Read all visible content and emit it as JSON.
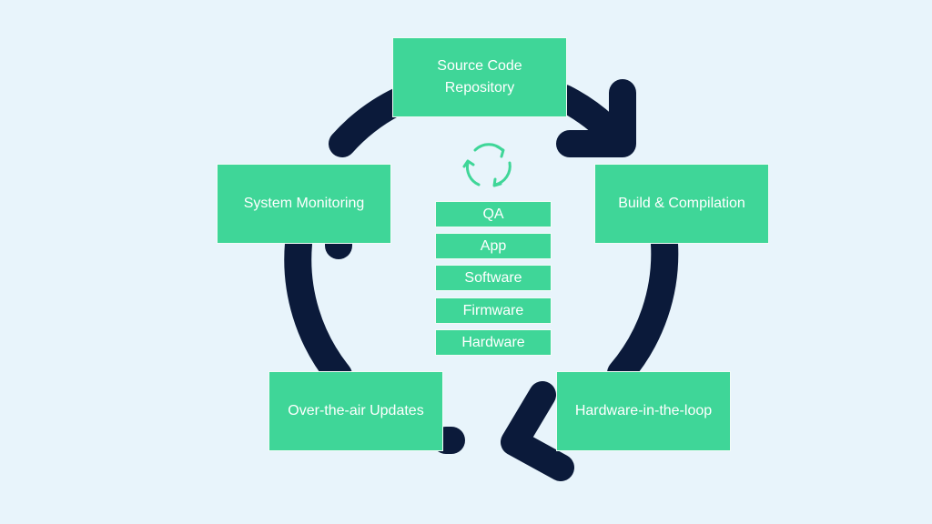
{
  "colors": {
    "background": "#e8f4fb",
    "box": "#3fd698",
    "ring": "#0b1a3a",
    "text": "#ffffff"
  },
  "stages": [
    {
      "id": "source",
      "label_lines": [
        "Source Code",
        "Repository"
      ]
    },
    {
      "id": "build",
      "label": "Build & Compilation"
    },
    {
      "id": "hil",
      "label": "Hardware-in-the-loop"
    },
    {
      "id": "ota",
      "label": "Over-the-air Updates"
    },
    {
      "id": "monitoring",
      "label": "System Monitoring"
    }
  ],
  "center": {
    "icon": "refresh-cycle-icon",
    "layers": [
      "QA",
      "App",
      "Software",
      "Firmware",
      "Hardware"
    ]
  }
}
